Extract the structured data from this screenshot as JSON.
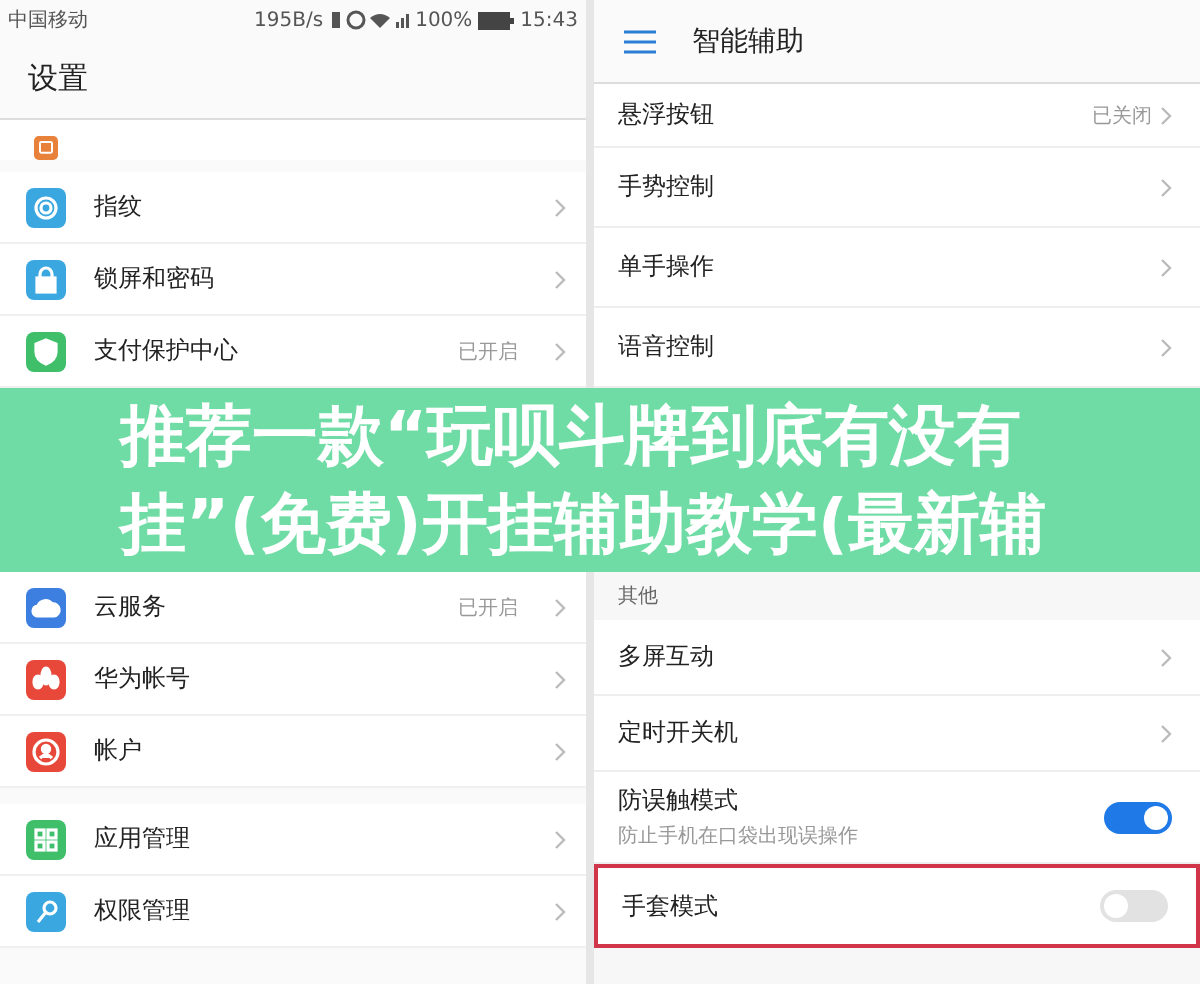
{
  "status_bar": {
    "carrier": "中国移动",
    "speed": "195B/s",
    "battery": "100%",
    "time": "15:43"
  },
  "left": {
    "title": "设置",
    "sections": [
      [
        {
          "color": "#e8823a",
          "highlighted": false
        }
      ],
      [
        {
          "label": "指纹",
          "color": "#3ba7e0",
          "highlighted": false
        },
        {
          "label": "锁屏和密码",
          "color": "#3ba7e0",
          "highlighted": false
        },
        {
          "label": "支付保护中心",
          "value": "已开启",
          "color": "#3fbf6a",
          "highlighted": false
        }
      ],
      [
        {
          "label": "云服务",
          "value": "已开启",
          "color": "#3d7fe0",
          "highlighted": false
        },
        {
          "label": "华为帐号",
          "color": "#e8483a",
          "highlighted": false
        },
        {
          "label": "帐户",
          "color": "#e8483a",
          "highlighted": false
        }
      ],
      [
        {
          "label": "应用管理",
          "color": "#3fbf6a",
          "highlighted": false
        },
        {
          "label": "权限管理",
          "color": "#3ba7e0",
          "highlighted": false
        }
      ]
    ]
  },
  "right": {
    "title": "智能辅助",
    "groups": [
      {
        "items": [
          {
            "label": "悬浮按钮",
            "value": "已关闭",
            "highlighted": false
          },
          {
            "label": "手势控制",
            "highlighted": false
          },
          {
            "label": "单手操作",
            "highlighted": false
          },
          {
            "label": "语音控制",
            "highlighted": false
          }
        ]
      },
      {
        "header": "其他",
        "items": [
          {
            "label": "多屏互动",
            "highlighted": false
          },
          {
            "label": "定时开关机",
            "highlighted": false
          },
          {
            "label": "防误触模式",
            "subtitle": "防止手机在口袋出现误操作",
            "toggle": {
              "on": true
            },
            "highlighted": false
          },
          {
            "label": "手套模式",
            "toggle": {
              "on": false
            },
            "highlighted": true
          }
        ]
      }
    ]
  },
  "banner": {
    "lines": [
      "推荐一款“玩呗斗牌到底有没有",
      "挂”(免费)开挂辅助教学(最新辅"
    ]
  }
}
